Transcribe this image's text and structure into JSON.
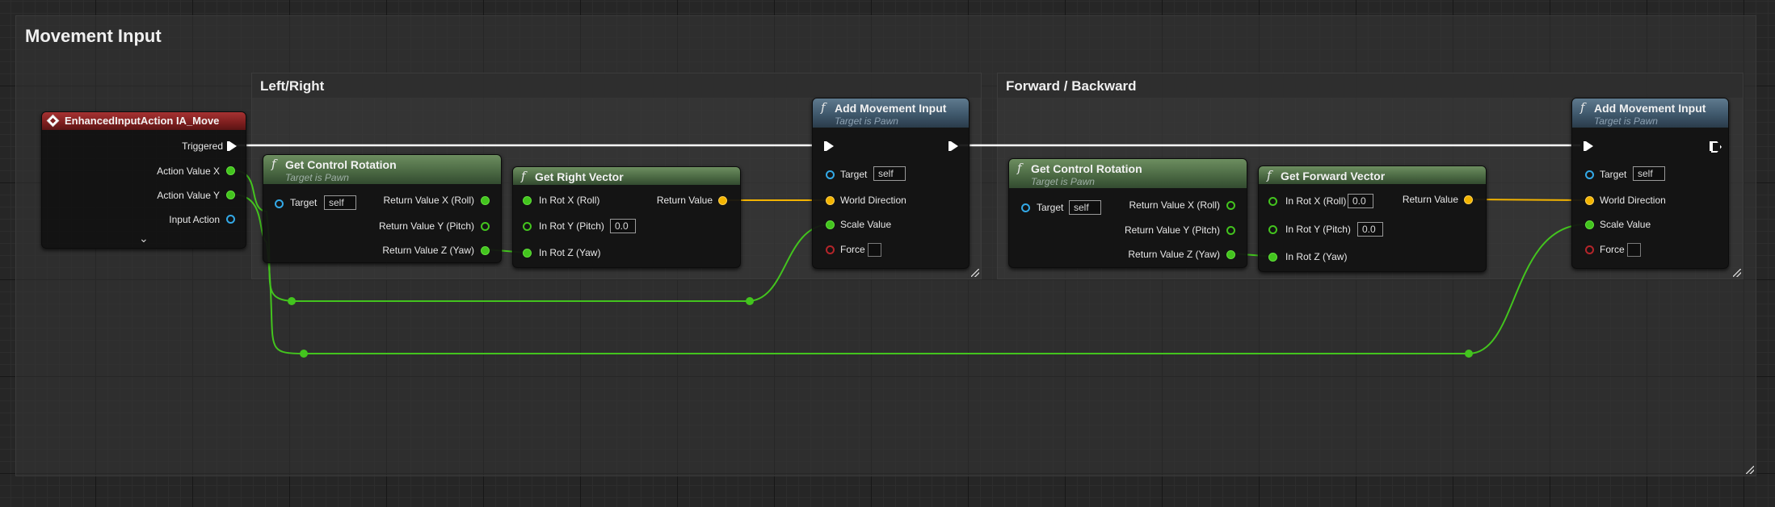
{
  "graph": {
    "comment_main": "Movement Input",
    "comment_left": "Left/Right",
    "comment_right": "Forward / Backward"
  },
  "event_node": {
    "title": "EnhancedInputAction IA_Move",
    "pins": {
      "triggered": "Triggered",
      "action_x": "Action Value X",
      "action_y": "Action Value Y",
      "input_action": "Input Action"
    }
  },
  "nodes": {
    "gcr1": {
      "title": "Get Control Rotation",
      "subtitle": "Target is Pawn",
      "target_label": "Target",
      "target_value": "self",
      "out_x": "Return Value X (Roll)",
      "out_y": "Return Value Y (Pitch)",
      "out_z": "Return Value Z (Yaw)"
    },
    "grv": {
      "title": "Get Right Vector",
      "in_x": "In Rot X (Roll)",
      "in_y": "In Rot Y (Pitch)",
      "in_y_value": "0.0",
      "in_z": "In Rot Z (Yaw)",
      "out": "Return Value"
    },
    "ami1": {
      "title": "Add Movement Input",
      "subtitle": "Target is Pawn",
      "target_label": "Target",
      "target_value": "self",
      "world_direction": "World Direction",
      "scale_value": "Scale Value",
      "force": "Force"
    },
    "gcr2": {
      "title": "Get Control Rotation",
      "subtitle": "Target is Pawn",
      "target_label": "Target",
      "target_value": "self",
      "out_x": "Return Value X (Roll)",
      "out_y": "Return Value Y (Pitch)",
      "out_z": "Return Value Z (Yaw)"
    },
    "gfv": {
      "title": "Get Forward Vector",
      "in_x": "In Rot X (Roll)",
      "in_x_value": "0.0",
      "in_y": "In Rot Y (Pitch)",
      "in_y_value": "0.0",
      "in_z": "In Rot Z (Yaw)",
      "out": "Return Value"
    },
    "ami2": {
      "title": "Add Movement Input",
      "subtitle": "Target is Pawn",
      "target_label": "Target",
      "target_value": "self",
      "world_direction": "World Direction",
      "scale_value": "Scale Value",
      "force": "Force"
    }
  },
  "colors": {
    "float_pin": "#43c41e",
    "vector_pin": "#f3b400",
    "object_pin": "#33a9e7",
    "bool_pin": "#b4252a",
    "exec": "#ffffff",
    "event_header": "#7d1e1e",
    "pure_header": "#4c6a44",
    "callable_header": "#3f586c"
  }
}
